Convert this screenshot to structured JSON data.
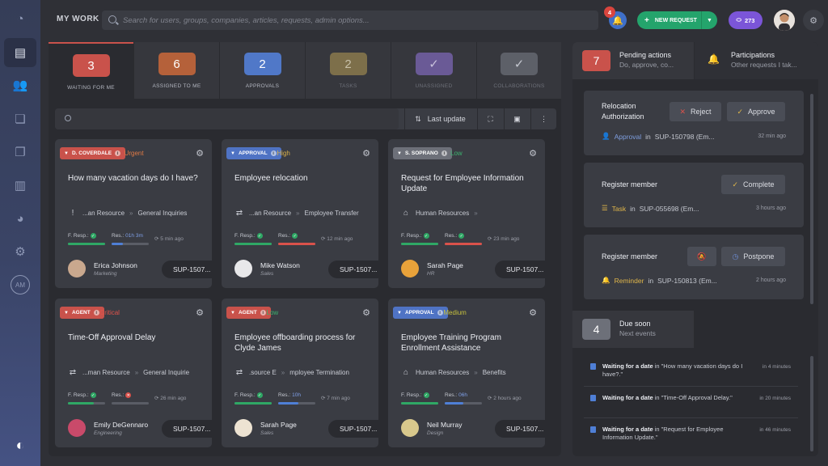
{
  "header": {
    "title": "MY WORK",
    "search_placeholder": "Search for users, groups, companies, articles, requests, admin options...",
    "notif_count": "4",
    "new_request_label": "NEW REQUEST",
    "points": "273"
  },
  "sidebar": {
    "items": [
      "dashboard-icon",
      "briefcase-icon",
      "users-icon",
      "documents-icon",
      "copy-icon",
      "book-icon",
      "pie-chart-icon",
      "gear-icon",
      "am-icon"
    ]
  },
  "tabs": [
    {
      "count": "3",
      "label": "WAITING FOR ME",
      "color": "#c9524b"
    },
    {
      "count": "6",
      "label": "ASSIGNED TO ME",
      "color": "#b5613a"
    },
    {
      "count": "2",
      "label": "APPROVALS",
      "color": "#5078c8"
    },
    {
      "count": "2",
      "label": "TASKS",
      "color": "#7d6f4a"
    },
    {
      "count": "✓",
      "label": "UNASSIGNED",
      "color": "#6a5a96"
    },
    {
      "count": "✓",
      "label": "COLLABORATIONS",
      "color": "#5d6068"
    }
  ],
  "toolbar": {
    "sort_label": "Last update"
  },
  "cards": [
    {
      "tag": "D. COVERDALE",
      "tag_color": "#c9524b",
      "priority": "Urgent",
      "priority_color": "#e07a45",
      "title": "How many vacation days do I have?",
      "meta_icon": "!",
      "meta_a": "...an Resource",
      "meta_b": "General Inquiries",
      "f_label": "F. Resp.:",
      "f_state": "ok",
      "r_label": "Res.:",
      "r_value": "01h 3m",
      "f_fill": 1.0,
      "r_fill": 0.3,
      "time": "5 min ago",
      "person": "Erica Johnson",
      "role": "Marketing",
      "avatar": "#c9a88e",
      "sup": "SUP-1507..."
    },
    {
      "tag": "APPROVAL",
      "tag_color": "#4f73c4",
      "priority": "High",
      "priority_color": "#d8b04a",
      "title": "Employee relocation",
      "meta_icon": "⇄",
      "meta_a": "...an Resource",
      "meta_b": "Employee Transfer",
      "f_label": "F. Resp.:",
      "f_state": "ok",
      "r_label": "Res.:",
      "r_value": "",
      "f_fill": 1.0,
      "r_fill": 1.0,
      "time": "12 min ago",
      "person": "Mike Watson",
      "role": "Sales",
      "avatar": "#e8e8ea",
      "sup": "SUP-1507..."
    },
    {
      "tag": "S. SOPRANO",
      "tag_color": "#6d7079",
      "priority": "Low",
      "priority_color": "#3bb26e",
      "title": "Request for Employee Information Update",
      "meta_icon": "⌂",
      "meta_a": "Human Resources",
      "meta_b": "",
      "f_label": "F. Resp.:",
      "f_state": "ok",
      "r_label": "Res.:",
      "r_value": "",
      "f_fill": 1.0,
      "r_fill": 1.0,
      "time": "23 min ago",
      "person": "Sarah Page",
      "role": "HR",
      "avatar": "#e8a23a",
      "sup": "SUP-1507..."
    },
    {
      "tag": "AGENT",
      "tag_color": "#c9524b",
      "priority": "Critical",
      "priority_color": "#e0524b",
      "title": "Time-Off Approval Delay",
      "meta_icon": "⇄",
      "meta_a": "...man Resource",
      "meta_b": "General Inquirie",
      "f_label": "F. Resp.:",
      "f_state": "ok",
      "r_label": "Res.:",
      "r_value": "",
      "f_fill": 0.7,
      "r_fill": 0.0,
      "time": "26 min ago",
      "person": "Emily DeGennaro",
      "role": "Engineering",
      "avatar": "#c94a6a",
      "sup": "SUP-1507..."
    },
    {
      "tag": "AGENT",
      "tag_color": "#c9524b",
      "priority": "Low",
      "priority_color": "#3bb26e",
      "title": "Employee offboarding process for Clyde James",
      "meta_icon": "⇄",
      "meta_a": ".source E",
      "meta_b": "mployee Termination",
      "f_label": "F. Resp.:",
      "f_state": "ok",
      "r_label": "Res.:",
      "r_value": "10h",
      "f_fill": 1.0,
      "r_fill": 0.55,
      "time": "7 min ago",
      "person": "Sarah Page",
      "role": "Sales",
      "avatar": "#ede3d2",
      "sup": "SUP-1507..."
    },
    {
      "tag": "APPROVAL",
      "tag_color": "#4f73c4",
      "priority": "Medium",
      "priority_color": "#c6c13e",
      "title": "Employee Training Program Enrollment Assistance",
      "meta_icon": "⌂",
      "meta_a": "Human Resources",
      "meta_b": "Benefits",
      "f_label": "F. Resp.:",
      "f_state": "ok",
      "r_label": "Res.:",
      "r_value": "06h",
      "f_fill": 1.0,
      "r_fill": 0.5,
      "time": "2 hours ago",
      "person": "Neil Murray",
      "role": "Design",
      "avatar": "#d8c88c",
      "sup": "SUP-1507..."
    }
  ],
  "pending": {
    "count": "7",
    "title": "Pending actions",
    "subtitle": "Do, approve, co..."
  },
  "participations": {
    "title": "Participations",
    "subtitle": "Other requests I tak..."
  },
  "actions": [
    {
      "title": "Relocation Authorization",
      "btn1": "Reject",
      "btn2": "Approve",
      "type": "Approval",
      "ref": "SUP-150798 (Em...",
      "time": "32 min ago"
    },
    {
      "title": "Register member",
      "btn2": "Complete",
      "type": "Task",
      "ref": "SUP-055698 (Em...",
      "time": "3 hours ago"
    },
    {
      "title": "Register member",
      "btn2": "Postpone",
      "type": "Reminder",
      "ref": "SUP-150813 (Em...",
      "time": "2 hours ago"
    }
  ],
  "in_label": "in",
  "due": {
    "count": "4",
    "title": "Due soon",
    "subtitle": "Next events"
  },
  "due_items": [
    {
      "label": "Waiting for a date",
      "rest": " in \"How many vacation days do I have?.\"",
      "time": "in 4 minutes"
    },
    {
      "label": "Waiting for a date",
      "rest": " in \"Time-Off Approval Delay.\"",
      "time": "in 20 minutes"
    },
    {
      "label": "Waiting for a date",
      "rest": " in \"Request for Employee Information Update.\"",
      "time": "in 46 minutes"
    }
  ]
}
